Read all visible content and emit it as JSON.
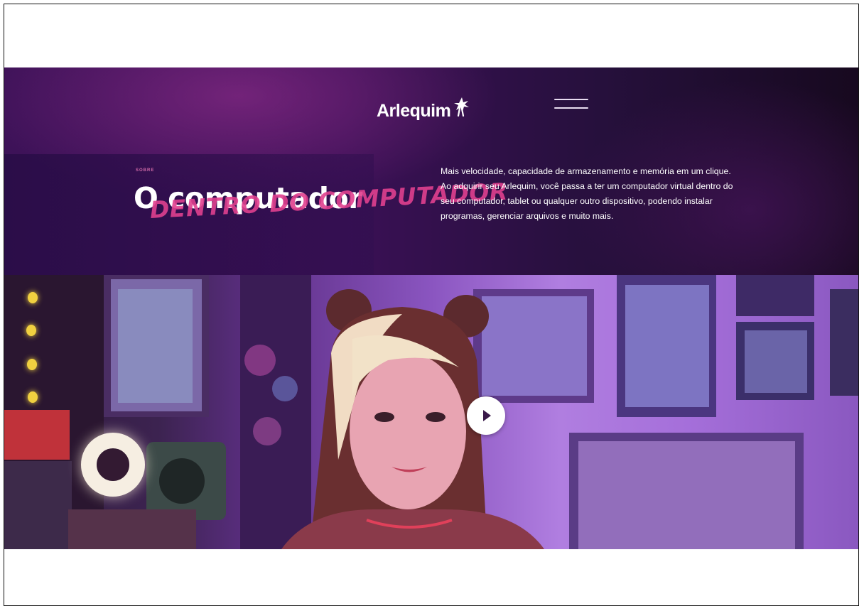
{
  "header": {
    "logo_text": "Arlequim",
    "menu_icon": "hamburger-menu-icon"
  },
  "hero": {
    "eyebrow": "SOBRE",
    "title": "O computador",
    "subtitle": "DENTRO DO COMPUTADOR",
    "description": "Mais velocidade, capacidade de armazenamento e memória em um clique. Ao adquirir seu Arlequim, você passa a ter um computador virtual dentro do seu computador, tablet ou qualquer outro dispositivo, podendo instalar programas, gerenciar arquivos e muito mais."
  },
  "video": {
    "play_icon": "play-icon"
  },
  "colors": {
    "brand_purple": "#3d1258",
    "accent_pink": "#e0408f",
    "text_white": "#ffffff"
  }
}
